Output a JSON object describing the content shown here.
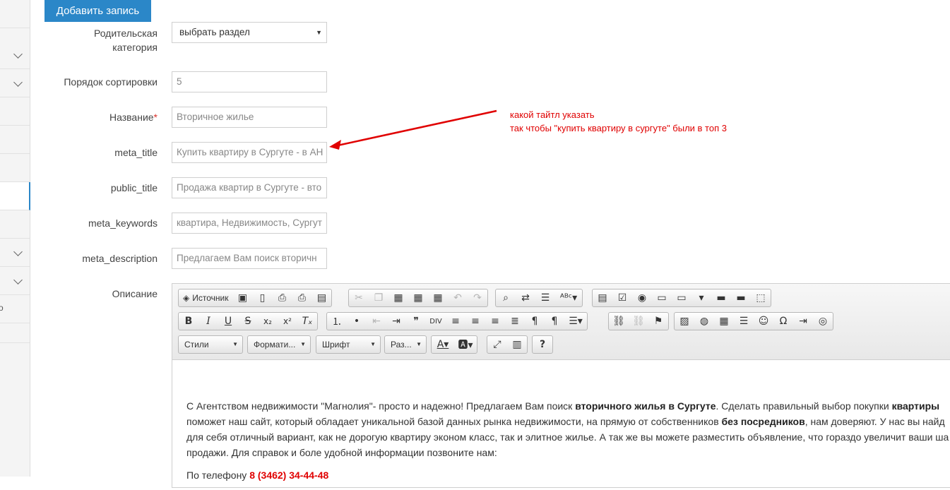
{
  "sidebar": {
    "items": [
      {
        "name": "item-1",
        "chevron": false
      },
      {
        "name": "item-2",
        "chevron": true
      },
      {
        "name": "item-3",
        "chevron": true
      },
      {
        "name": "item-4",
        "chevron": false
      },
      {
        "name": "item-5",
        "chevron": false
      },
      {
        "name": "item-6",
        "chevron": false,
        "active": true
      },
      {
        "name": "item-7",
        "chevron": false
      },
      {
        "name": "item-8",
        "chevron": true
      },
      {
        "name": "item-9",
        "chevron": true
      },
      {
        "name": "item-10",
        "text": "о"
      }
    ],
    "partial_text": "о"
  },
  "add_button": "Добавить запись",
  "form": {
    "parent_label_1": "Родительская",
    "parent_label_2": "категория",
    "parent_value": "выбрать раздел",
    "sort_label": "Порядок сортировки",
    "sort_value": "5",
    "name_label": "Название",
    "name_required": "*",
    "name_value": "Вторичное жилье",
    "meta_title_label": "meta_title",
    "meta_title_value": "Купить квартиру в Сургуте - в АН",
    "public_title_label": "public_title",
    "public_title_value": "Продажа квартир в Сургуте - вто",
    "meta_keywords_label": "meta_keywords",
    "meta_keywords_value": "квартира, Недвижимость, Сургут",
    "meta_description_label": "meta_description",
    "meta_description_value": "Предлагаем Вам поиск вторичн",
    "description_label": "Описание"
  },
  "annotation": {
    "line1": "какой тайтл указать",
    "line2": "так чтобы \"купить квартиру в сургуте\" были в топ 3",
    "color": "#e00000"
  },
  "editor": {
    "source_label": "Источник",
    "styles_label": "Стили",
    "format_label": "Формати...",
    "font_label": "Шрифт",
    "size_label": "Раз...",
    "body": {
      "p1_a": "С Агентством недвижимости \"Магнолия\"- просто и надежно! Предлагаем Вам поиск ",
      "p1_b": "вторичного жилья в Сургуте",
      "p1_c": ". Сделать правильный выбор покупки ",
      "p1_d": "квартиры",
      "p1_e": "поможет наш сайт, который обладает уникальной базой данных рынка недвижимости, на прямую от собственников ",
      "p1_f": "без посредников",
      "p1_g": ", нам доверяют. У нас вы найд",
      "p1_h": "для себя отличный вариант, как не дорогую квартиру эконом класс, так и элитное жилье. А так же вы можете разместить объявление, что гораздо увеличит ваши ша",
      "p1_i": "продажи. Для справок и боле удобной информации позвоните нам:",
      "p2_a": "По телефону ",
      "p2_b": "8 (3462) 34-44-48"
    }
  },
  "colors": {
    "accent": "#2b87c8",
    "required": "#d9312b"
  }
}
